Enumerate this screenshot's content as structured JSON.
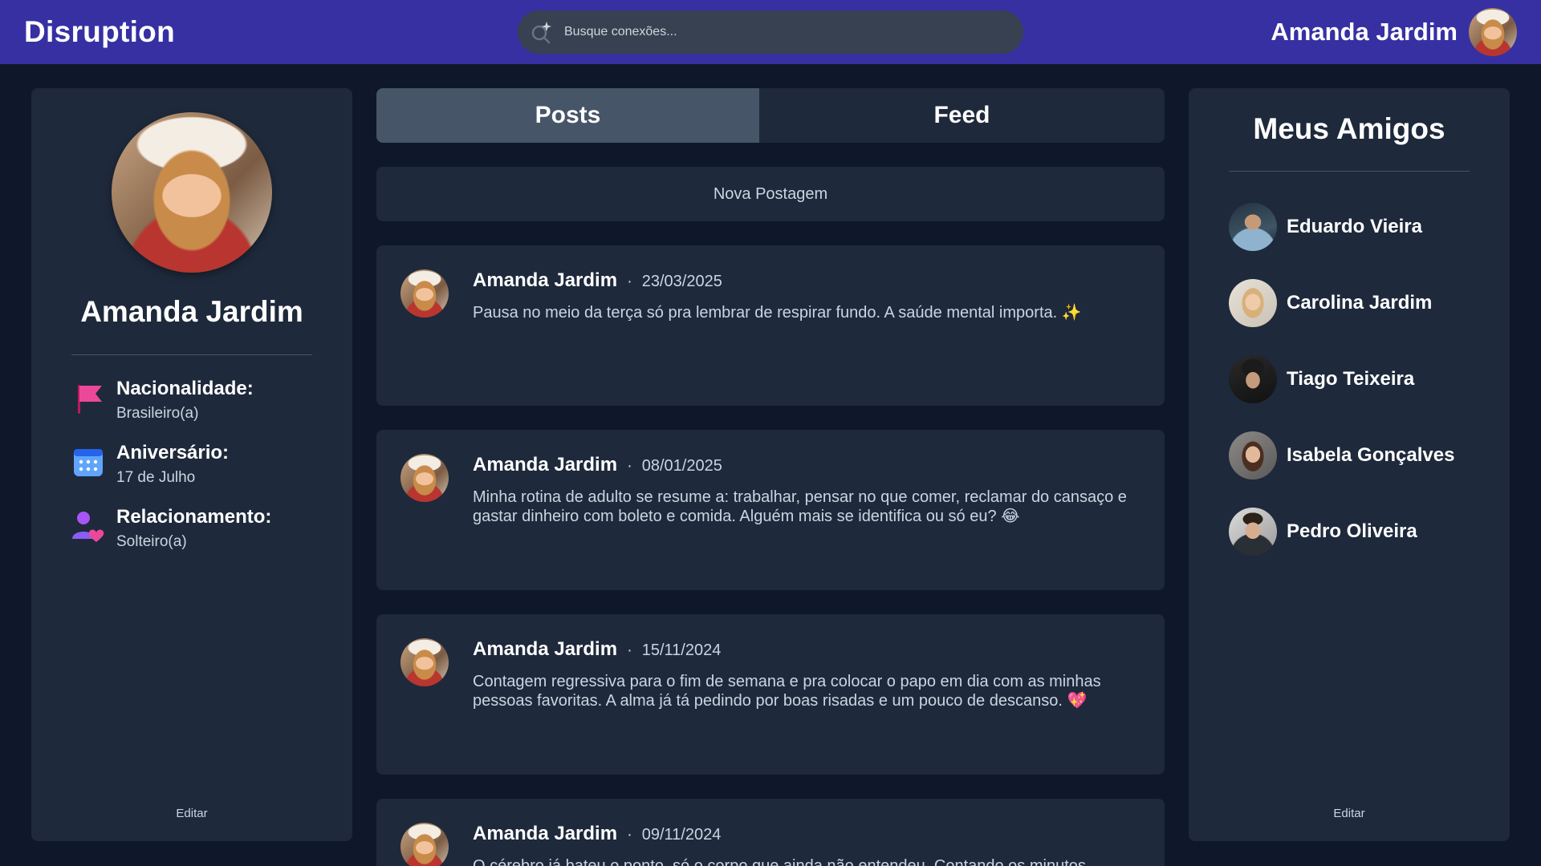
{
  "app": {
    "brand": "Disruption",
    "search_placeholder": "Busque conexões...",
    "current_user": "Amanda Jardim"
  },
  "profile": {
    "name": "Amanda Jardim",
    "details": [
      {
        "label": "Nacionalidade:",
        "value": "Brasileiro(a)",
        "icon": "flag-icon"
      },
      {
        "label": "Aniversário:",
        "value": "17 de Julho",
        "icon": "calendar-icon"
      },
      {
        "label": "Relacionamento:",
        "value": "Solteiro(a)",
        "icon": "relationship-icon"
      }
    ],
    "edit_label": "Editar"
  },
  "tabs": [
    {
      "label": "Posts",
      "active": true
    },
    {
      "label": "Feed",
      "active": false
    }
  ],
  "new_post_label": "Nova Postagem",
  "posts": [
    {
      "author": "Amanda Jardim",
      "date": "23/03/2025",
      "text": "Pausa no meio da terça só pra lembrar de respirar fundo. A saúde mental importa. ✨"
    },
    {
      "author": "Amanda Jardim",
      "date": "08/01/2025",
      "text": "Minha rotina de adulto se resume a: trabalhar, pensar no que comer, reclamar do cansaço e gastar dinheiro com boleto e comida. Alguém mais se identifica ou só eu? 😂"
    },
    {
      "author": "Amanda Jardim",
      "date": "15/11/2024",
      "text": "Contagem regressiva para o fim de semana e pra colocar o papo em dia com as minhas pessoas favoritas. A alma já tá pedindo por boas risadas e um pouco de descanso. 💖"
    },
    {
      "author": "Amanda Jardim",
      "date": "09/11/2024",
      "text": "O cérebro já bateu o ponto, só o corpo que ainda não entendeu. Contando os minutos"
    }
  ],
  "post_separator": "·",
  "friends": {
    "title": "Meus Amigos",
    "list": [
      {
        "name": "Eduardo Vieira"
      },
      {
        "name": "Carolina Jardim"
      },
      {
        "name": "Tiago Teixeira"
      },
      {
        "name": "Isabela Gonçalves"
      },
      {
        "name": "Pedro Oliveira"
      }
    ],
    "edit_label": "Editar"
  },
  "colors": {
    "topbar": "#3730a3",
    "background": "#0f172a",
    "panel": "#1e293b",
    "active_tab": "#475569",
    "flag": "#ec4899",
    "calendar": "#3b82f6",
    "relationship_person": "#a855f7",
    "relationship_heart": "#ec4899"
  }
}
